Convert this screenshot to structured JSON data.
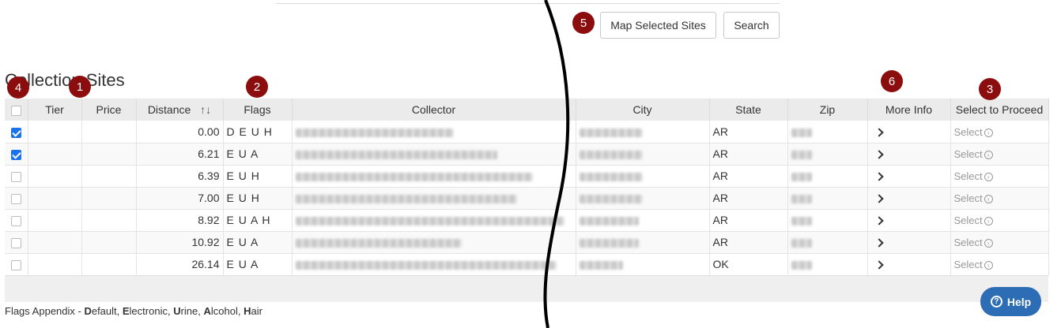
{
  "toolbar": {
    "map_selected_label": "Map Selected Sites",
    "search_label": "Search"
  },
  "page": {
    "heading": "Collection Sites"
  },
  "markers": {
    "m1": "1",
    "m2": "2",
    "m3": "3",
    "m4": "4",
    "m5": "5",
    "m6": "6"
  },
  "table": {
    "headers": {
      "tier": "Tier",
      "price": "Price",
      "distance": "Distance",
      "sort_icon": "↑↓",
      "flags": "Flags",
      "collector": "Collector",
      "city": "City",
      "state": "State",
      "zip": "Zip",
      "more_info": "More Info",
      "select": "Select to Proceed"
    },
    "rows": [
      {
        "checked": true,
        "distance": "0.00",
        "flags": "D E U H",
        "state": "AR",
        "select": "Select"
      },
      {
        "checked": true,
        "distance": "6.21",
        "flags": "E U A",
        "state": "AR",
        "select": "Select"
      },
      {
        "checked": false,
        "distance": "6.39",
        "flags": "E U H",
        "state": "AR",
        "select": "Select"
      },
      {
        "checked": false,
        "distance": "7.00",
        "flags": "E U H",
        "state": "AR",
        "select": "Select"
      },
      {
        "checked": false,
        "distance": "8.92",
        "flags": "E U A H",
        "state": "AR",
        "select": "Select"
      },
      {
        "checked": false,
        "distance": "10.92",
        "flags": "E U A",
        "state": "AR",
        "select": "Select"
      },
      {
        "checked": false,
        "distance": "26.14",
        "flags": "E U A",
        "state": "OK",
        "select": "Select"
      }
    ]
  },
  "appendix": {
    "prefix": "Flags Appendix - ",
    "items": [
      {
        "bold": "D",
        "rest": "efault, "
      },
      {
        "bold": "E",
        "rest": "lectronic, "
      },
      {
        "bold": "U",
        "rest": "rine, "
      },
      {
        "bold": "A",
        "rest": "lcohol, "
      },
      {
        "bold": "H",
        "rest": "air"
      }
    ]
  },
  "help": {
    "label": "Help",
    "icon": "question-icon"
  },
  "colors": {
    "marker": "#8b0d0d",
    "checkbox_checked": "#1a73e8",
    "help_button": "#2d6db5"
  }
}
